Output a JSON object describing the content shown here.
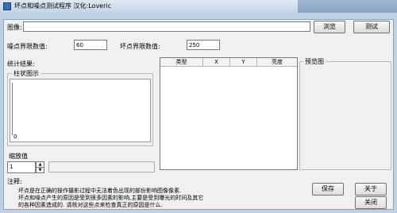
{
  "window": {
    "title": "坏点和噪点测试程序 汉化:Loveric"
  },
  "image_row": {
    "label": "图像:",
    "path_value": "",
    "browse_label": "浏览",
    "test_label": "测试"
  },
  "thresholds": {
    "noise_label": "噪点界限数值:",
    "noise_value": "60",
    "dead_label": "坏点界限数值:",
    "dead_value": "250"
  },
  "results": {
    "group_label": "统计结果:",
    "histogram_label": "柱状图示",
    "histogram_zero": "0",
    "columns": [
      "类型",
      "X",
      "Y",
      "亮度"
    ],
    "rows": []
  },
  "preview": {
    "label": "预览图"
  },
  "zoom": {
    "label": "缩放值",
    "value": "1"
  },
  "notes": {
    "heading": "注释:",
    "line1": "坏点是在正确的操作摄影过程中无法着色出现的部份影响图像像素.",
    "line2": "坏点和噪点产生的原因是受到很多因素的影响,主要是受到曝光的时间及其它",
    "line3": "的各种因素造成的. 请核对这些点来检查真正的原因是什么."
  },
  "buttons": {
    "save": "保存",
    "about": "关于",
    "close": "关闭"
  }
}
